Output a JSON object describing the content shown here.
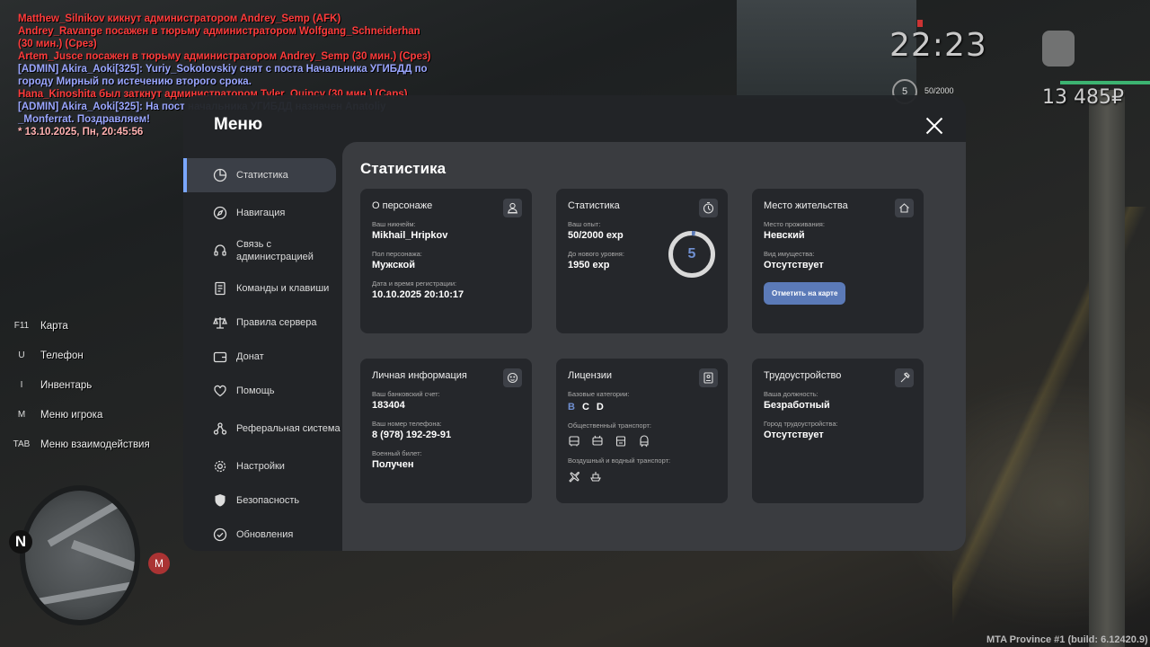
{
  "chat": [
    {
      "text": "Matthew_Silnikov кикнут администратором Andrey_Semp (AFK)",
      "color": "red"
    },
    {
      "text": "Andrey_Ravange посажен в тюрьму администратором Wolfgang_Schneiderhan",
      "color": "red"
    },
    {
      "text": "(30 мин.) (Срез)",
      "color": "red"
    },
    {
      "text": "Artem_Jusce посажен в тюрьму администратором Andrey_Semp (30 мин.) (Срез)",
      "color": "red"
    },
    {
      "text": "[ADMIN] Akira_Aoki[325]: Yuriy_Sokolovskiy снят с поста Начальника УГИБДД по",
      "color": "blue"
    },
    {
      "text": " городу Мирный по истечению второго срока.",
      "color": "blue"
    },
    {
      "text": "Hana_Kinoshita был заткнут администратором Tyler_Quincy (30 мин.) (Caps)",
      "color": "red"
    },
    {
      "text": "[ADMIN] Akira_Aoki[325]: На пост начальника УГИБДД назначен Anatoliy",
      "color": "blue"
    },
    {
      "text": "_Monferrat. Поздравляем!",
      "color": "blue"
    },
    {
      "text": "* 13.10.2025, Пн, 20:45:56",
      "color": "gray"
    }
  ],
  "hud": {
    "time": "22:23",
    "money": "13 485₽",
    "level": "5",
    "xp": "50/2000"
  },
  "binds": [
    {
      "key": "F11",
      "label": "Карта"
    },
    {
      "key": "U",
      "label": "Телефон"
    },
    {
      "key": "I",
      "label": "Инвентарь"
    },
    {
      "key": "M",
      "label": "Меню игрока"
    },
    {
      "key": "TAB",
      "label": "Меню взаимодействия"
    }
  ],
  "minimap": {
    "north": "N",
    "metro": "М"
  },
  "build": "MTA Province #1 (build: 6.12420.9)",
  "menu": {
    "title": "Меню",
    "nav": [
      {
        "label": "Статистика",
        "icon": "pie-chart-icon"
      },
      {
        "label": "Навигация",
        "icon": "compass-icon"
      },
      {
        "label": "Связь с администрацией",
        "icon": "headset-icon"
      },
      {
        "label": "Команды и клавиши",
        "icon": "document-icon"
      },
      {
        "label": "Правила сервера",
        "icon": "scales-icon"
      },
      {
        "label": "Донат",
        "icon": "wallet-icon"
      },
      {
        "label": "Помощь",
        "icon": "heart-hand-icon"
      },
      {
        "label": "Реферальная система",
        "icon": "network-icon"
      },
      {
        "label": "Настройки",
        "icon": "gear-icon"
      },
      {
        "label": "Безопасность",
        "icon": "shield-icon"
      },
      {
        "label": "Обновления",
        "icon": "refresh-check-icon"
      }
    ],
    "active": "Статистика"
  },
  "stats": {
    "title": "Статистика",
    "character": {
      "title": "О персонаже",
      "nick_label": "Ваш никнейм:",
      "nick": "Mikhail_Hripkov",
      "gender_label": "Пол персонажа:",
      "gender": "Мужской",
      "reg_label": "Дата и время регистрации:",
      "reg": "10.10.2025 20:10:17"
    },
    "statistics": {
      "title": "Статистика",
      "xp_label": "Ваш опыт:",
      "xp": "50/2000 exp",
      "next_label": "До нового уровня:",
      "next": "1950 exp",
      "level": "5",
      "progress": 0.025
    },
    "residence": {
      "title": "Место жительства",
      "place_label": "Место проживания:",
      "place": "Невский",
      "property_label": "Вид имущества:",
      "property": "Отсутствует",
      "button": "Отметить на карте"
    },
    "personal": {
      "title": "Личная информация",
      "bank_label": "Ваш банковский счет:",
      "bank": "183404",
      "phone_label": "Ваш номер телефона:",
      "phone": "8 (978) 192-29-91",
      "military_label": "Военный билет:",
      "military": "Получен"
    },
    "licenses": {
      "title": "Лицензии",
      "basic_label": "Базовые категории:",
      "categories": [
        "B",
        "C",
        "D"
      ],
      "public_label": "Общественный транспорт:",
      "air_label": "Воздушный и водный транспорт:"
    },
    "employment": {
      "title": "Трудоустройство",
      "job_label": "Ваша должность:",
      "job": "Безработный",
      "city_label": "Город трудоустройства:",
      "city": "Отсутствует"
    }
  }
}
